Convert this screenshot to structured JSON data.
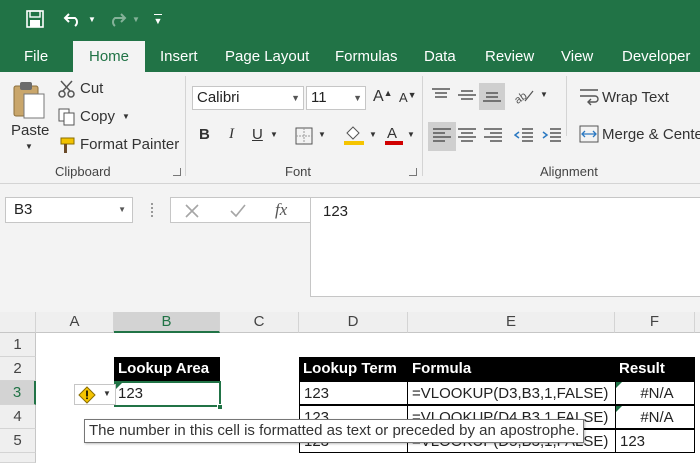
{
  "colors": {
    "accent": "#217346",
    "header_black": "#000000",
    "warning": "#f5c400"
  },
  "qat": {
    "save_icon": "save-icon",
    "undo_icon": "undo-icon",
    "redo_icon": "redo-icon",
    "customize_icon": "customize-qat-icon"
  },
  "tabs": [
    "File",
    "Home",
    "Insert",
    "Page Layout",
    "Formulas",
    "Data",
    "Review",
    "View",
    "Developer"
  ],
  "active_tab": "Home",
  "ribbon": {
    "clipboard": {
      "paste": "Paste",
      "cut": "Cut",
      "copy": "Copy",
      "format_painter": "Format Painter",
      "group_label": "Clipboard"
    },
    "font": {
      "name": "Calibri",
      "size": "11",
      "group_label": "Font",
      "bold": "B",
      "italic": "I",
      "underline": "U"
    },
    "alignment": {
      "wrap_text": "Wrap Text",
      "merge_center": "Merge & Cente",
      "group_label": "Alignment"
    }
  },
  "formula_bar": {
    "name_box": "B3",
    "fx": "fx",
    "value": "123"
  },
  "grid": {
    "columns": [
      "A",
      "B",
      "C",
      "D",
      "E",
      "F"
    ],
    "selected_column": "B",
    "rows": [
      "1",
      "2",
      "3",
      "4",
      "5"
    ],
    "selected_row": "3",
    "cells": {
      "B2": "Lookup Area",
      "B3": "123",
      "D2": "Lookup Term",
      "E2": "Formula",
      "F2": "Result",
      "D3": "123",
      "E3": "=VLOOKUP(D3,B3,1,FALSE)",
      "F3": "#N/A",
      "D4": "123",
      "E4": "=VLOOKUP(D4,B3,1,FALSE)",
      "F4": "#N/A",
      "D5": "123",
      "E5": "=VLOOKUP(D5,B3,1,FALSE)",
      "F5": "123"
    },
    "error_tooltip": "The number in this cell is formatted as text or preceded by an apostrophe."
  }
}
